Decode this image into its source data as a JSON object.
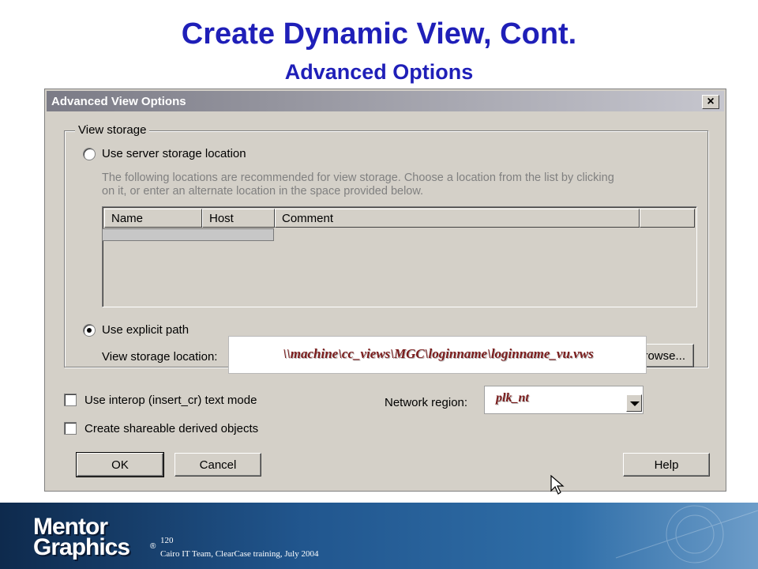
{
  "slide": {
    "title": "Create Dynamic View, Cont.",
    "subtitle": "Advanced Options"
  },
  "dialog": {
    "title": "Advanced View Options",
    "close_label": "×",
    "view_storage": {
      "group_label": "View storage",
      "server_option": {
        "label": "Use server storage location",
        "selected": false
      },
      "info_text_line1": "The following locations are recommended for view storage. Choose a location from the list by clicking",
      "info_text_line2": "on it, or enter an alternate location in the space provided below.",
      "columns": [
        "Name",
        "Host",
        "Comment"
      ],
      "explicit_option": {
        "label": "Use explicit path",
        "selected": true
      },
      "storage_location_label": "View storage location:",
      "storage_location_value": "\\\\machine\\cc_views\\MGC\\loginname\\loginname_vu.vws",
      "browse_label": "Browse..."
    },
    "interop_checkbox": {
      "label": "Use interop (insert_cr) text mode",
      "checked": false
    },
    "shareable_checkbox": {
      "label": "Create shareable derived objects",
      "checked": false
    },
    "network_region_label": "Network region:",
    "network_region_value": "plk_nt",
    "buttons": {
      "ok": "OK",
      "cancel": "Cancel",
      "help": "Help"
    }
  },
  "footer": {
    "logo_line1": "Mentor",
    "logo_line2": "Graphics",
    "logo_reg": "®",
    "page_number": "120",
    "note": "Cairo IT Team, ClearCase training, July 2004"
  }
}
